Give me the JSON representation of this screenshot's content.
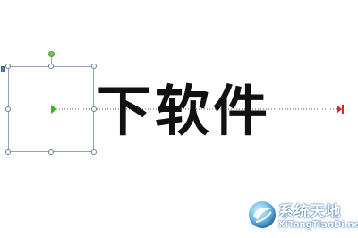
{
  "slide": {
    "text": "下软件"
  },
  "watermark": {
    "title": "系统天地",
    "url": "XiTongTianDi.net"
  }
}
